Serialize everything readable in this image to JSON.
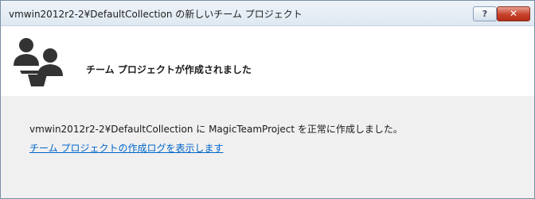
{
  "window": {
    "title": "vmwin2012r2-2¥DefaultCollection の新しいチーム プロジェクト",
    "help_label": "?",
    "close_label": "✕"
  },
  "header": {
    "icon": "team-project-icon",
    "text": "チーム プロジェクトが作成されました"
  },
  "content": {
    "message": "vmwin2012r2-2¥DefaultCollection に MagicTeamProject を正常に作成しました。",
    "log_link": "チーム プロジェクトの作成ログを表示します"
  },
  "colors": {
    "link": "#0066cc",
    "close_button": "#c7412a",
    "icon": "#333333"
  }
}
